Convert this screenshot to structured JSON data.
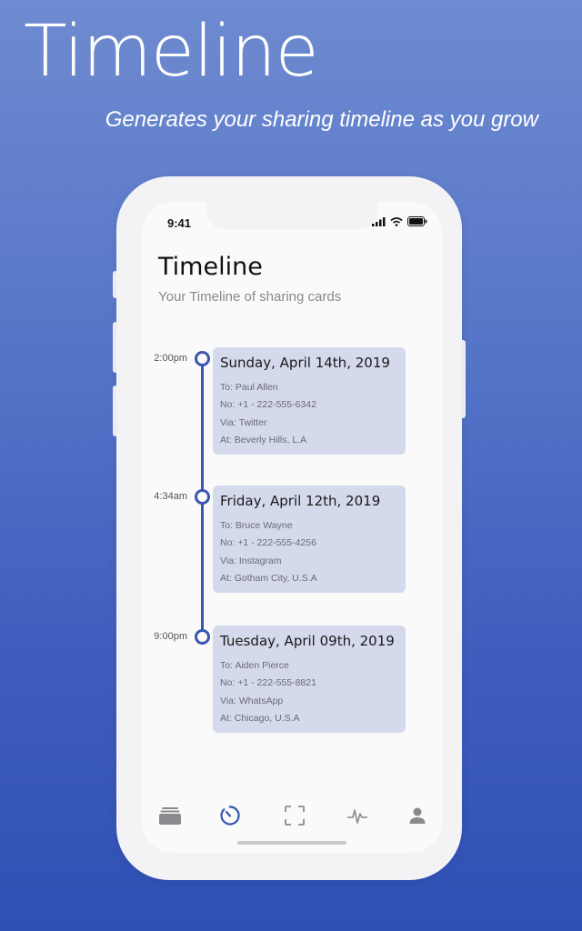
{
  "hero": {
    "title": "Timeline",
    "subtitle": "Generates your sharing timeline as you grow"
  },
  "status_bar": {
    "time": "9:41"
  },
  "screen": {
    "title": "Timeline",
    "subtitle": "Your Timeline of sharing cards"
  },
  "entries": [
    {
      "time": "2:00pm",
      "date": "Sunday, April 14th, 2019",
      "to": "To: Paul Allen",
      "no": "No: +1 - 222-555-6342",
      "via": "Via: Twitter",
      "at": "At: Beverly Hills, L.A"
    },
    {
      "time": "4:34am",
      "date": "Friday, April 12th, 2019",
      "to": "To: Bruce Wayne",
      "no": "No: +1 - 222-555-4256",
      "via": "Via: Instagram",
      "at": "At: Gotham City, U.S.A"
    },
    {
      "time": "9:00pm",
      "date": "Tuesday, April 09th, 2019",
      "to": "To: Aiden Pierce",
      "no": "No: +1 - 222-555-8821",
      "via": "Via: WhatsApp",
      "at": "At: Chicago, U.S.A"
    }
  ],
  "tabs": [
    {
      "icon": "cards-icon",
      "active": false
    },
    {
      "icon": "timeline-icon",
      "active": true
    },
    {
      "icon": "scan-icon",
      "active": false
    },
    {
      "icon": "activity-icon",
      "active": false
    },
    {
      "icon": "profile-icon",
      "active": false
    }
  ],
  "colors": {
    "accent": "#3a56b0",
    "card_bg": "#d4d9ec",
    "inactive_icon": "#8a8a8e"
  }
}
